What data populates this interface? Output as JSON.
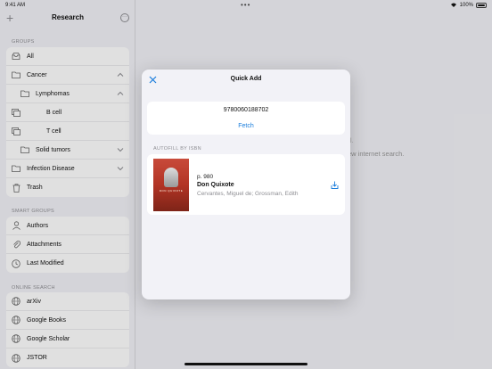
{
  "status": {
    "time": "9:41 AM",
    "battery": "100%"
  },
  "sidebar": {
    "title": "Research",
    "groups_label": "GROUPS",
    "groups": [
      {
        "label": "All",
        "icon": "tray-icon"
      },
      {
        "label": "Cancer",
        "icon": "folder-icon"
      },
      {
        "label": "Lymphomas",
        "icon": "folder-icon"
      },
      {
        "label": "B cell",
        "icon": "copy-icon"
      },
      {
        "label": "T cell",
        "icon": "copy-icon"
      },
      {
        "label": "Solid tumors",
        "icon": "folder-icon"
      },
      {
        "label": "Infection Disease",
        "icon": "folder-icon"
      },
      {
        "label": "Trash",
        "icon": "trash-icon"
      }
    ],
    "smart_label": "SMART GROUPS",
    "smart": [
      {
        "label": "Authors",
        "icon": "person-icon"
      },
      {
        "label": "Attachments",
        "icon": "paperclip-icon"
      },
      {
        "label": "Last Modified",
        "icon": "clock-icon"
      }
    ],
    "online_label": "ONLINE SEARCH",
    "online": [
      {
        "label": "arXiv",
        "icon": "globe-icon"
      },
      {
        "label": "Google Books",
        "icon": "globe-icon"
      },
      {
        "label": "Google Scholar",
        "icon": "globe-icon"
      },
      {
        "label": "JSTOR",
        "icon": "globe-icon"
      }
    ]
  },
  "background": {
    "line1": "l.",
    "line2": "ew internet search."
  },
  "modal": {
    "title": "Quick Add",
    "isbn": "9780060188702",
    "fetch_label": "Fetch",
    "autofill_label": "AUTOFILL BY ISBN",
    "result": {
      "pages": "p. 980",
      "title": "Don Quixote",
      "authors": "Cervantes, Miguel de; Grossman, Edith",
      "cover_text": "DON QUIXOTE"
    }
  },
  "colors": {
    "accent": "#1a7ddc",
    "background": "#f2f2f7"
  }
}
